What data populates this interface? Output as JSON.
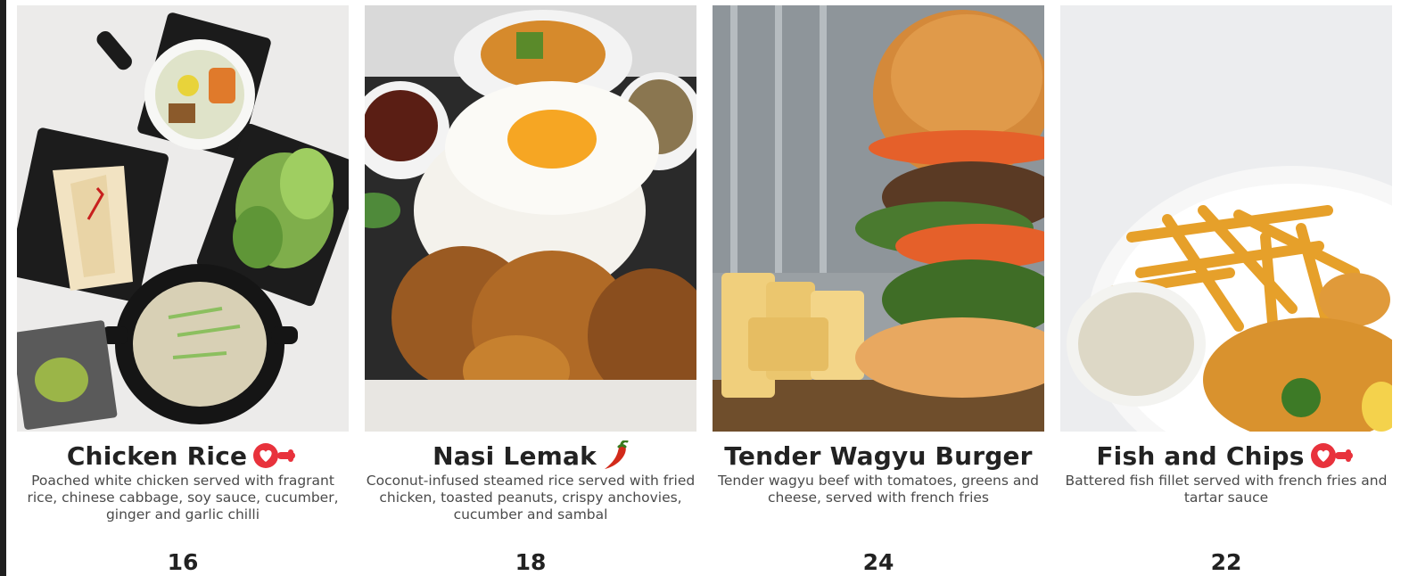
{
  "menu": {
    "items": [
      {
        "name": "Chicken Rice",
        "description": "Poached white chicken served with fragrant rice, chinese cabbage, soy sauce, cucumber, ginger and garlic chilli",
        "price": "16",
        "badge_icon": "heart-icon",
        "photo": "chicken-rice-photo"
      },
      {
        "name": "Nasi Lemak",
        "description": "Coconut-infused steamed rice served with fried chicken, toasted peanuts, crispy anchovies, cucumber and sambal",
        "price": "18",
        "badge_icon": "chilli-icon",
        "photo": "nasi-lemak-photo"
      },
      {
        "name": "Tender Wagyu Burger",
        "description": "Tender wagyu beef with tomatoes, greens and cheese, served with french fries",
        "price": "24",
        "badge_icon": "",
        "photo": "wagyu-burger-photo"
      },
      {
        "name": "Fish and Chips",
        "description": "Battered fish fillet served with french fries and tartar sauce",
        "price": "22",
        "badge_icon": "heart-icon",
        "photo": "fish-and-chips-photo"
      }
    ]
  },
  "colors": {
    "heart_badge": "#e8323c",
    "chilli": "#d22a1a",
    "text": "#222222",
    "description": "#4a4a4a"
  }
}
